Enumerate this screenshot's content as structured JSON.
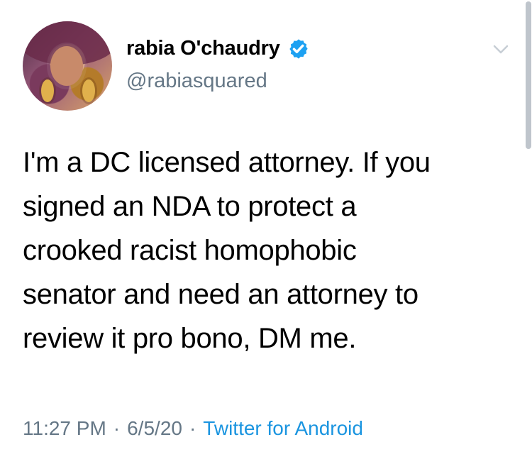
{
  "tweet": {
    "author_name": "rabia O'chaudry",
    "handle": "@rabiasquared",
    "text": "I'm a DC licensed attorney. If you\nsigned an NDA to protect a\ncrooked racist homophobic\nsenator and need an attorney to\nreview it pro bono, DM me.",
    "time": "11:27 PM",
    "separator": "·",
    "date": "6/5/20",
    "source": "Twitter for Android"
  },
  "icons": {
    "verified": "verified-badge-icon",
    "menu": "chevron-down-icon",
    "avatar": "profile-photo"
  },
  "colors": {
    "verified": "#1da1f2",
    "secondary_text": "#657786",
    "link": "#1b95e0"
  }
}
